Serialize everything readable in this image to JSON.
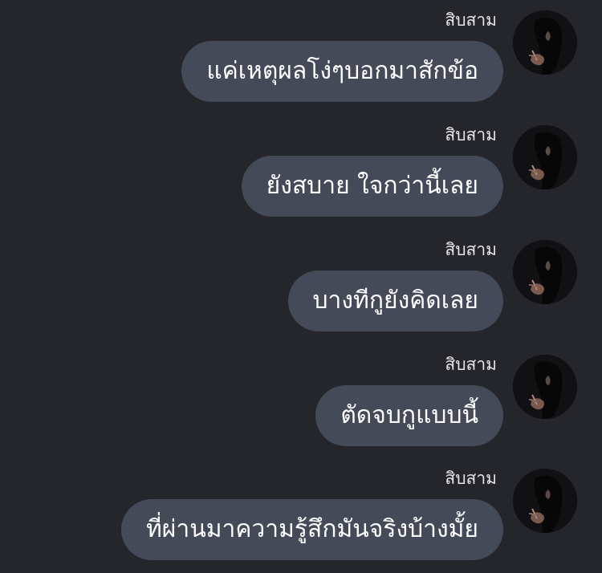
{
  "messages": [
    {
      "sender": "สิบสาม",
      "text": "แค่เหตุผลโง่ๆบอกมาสักข้อ"
    },
    {
      "sender": "สิบสาม",
      "text": "ยังสบาย ใจกว่านี้เลย"
    },
    {
      "sender": "สิบสาม",
      "text": "บางทีกูยังคิดเลย"
    },
    {
      "sender": "สิบสาม",
      "text": "ตัดจบกูแบบนี้"
    },
    {
      "sender": "สิบสาม",
      "text": "ที่ผ่านมาความรู้สึกมันจริงบ้างมั้ย"
    }
  ],
  "colors": {
    "background": "#25262b",
    "bubble": "#454a59",
    "text": "#ffffff",
    "sender_text": "#e6e6e8"
  },
  "icons": {
    "avatar": "profile-photo"
  }
}
